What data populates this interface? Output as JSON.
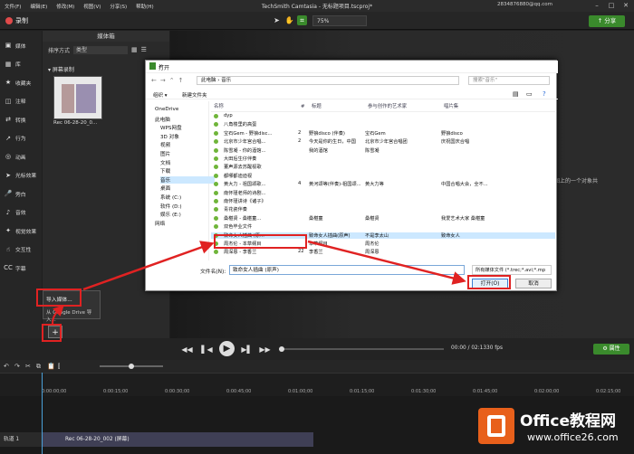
{
  "menubar": {
    "items": [
      "文件(F)",
      "编辑(E)",
      "修改(M)",
      "视图(V)",
      "分享(S)",
      "帮助(H)"
    ],
    "title": "TechSmith Camtasia - 无标题项目.tscproj*",
    "email": "2834876880@qq.com"
  },
  "toolbar": {
    "record": "录制",
    "zoom": "75%",
    "share": "分享"
  },
  "sidebar": {
    "items": [
      {
        "icon": "media-icon",
        "label": "媒体"
      },
      {
        "icon": "library-icon",
        "label": "库"
      },
      {
        "icon": "favorites-icon",
        "label": "收藏夹"
      },
      {
        "icon": "annotations-icon",
        "label": "注释"
      },
      {
        "icon": "transitions-icon",
        "label": "转换"
      },
      {
        "icon": "behaviors-icon",
        "label": "行为"
      },
      {
        "icon": "animations-icon",
        "label": "动画"
      },
      {
        "icon": "cursor-effects-icon",
        "label": "光标效果"
      },
      {
        "icon": "narration-icon",
        "label": "旁白"
      },
      {
        "icon": "audio-effects-icon",
        "label": "音效"
      },
      {
        "icon": "visual-effects-icon",
        "label": "视觉效果"
      },
      {
        "icon": "interactivity-icon",
        "label": "交互性"
      },
      {
        "icon": "captions-icon",
        "label": "字幕"
      }
    ]
  },
  "media": {
    "title": "媒体箱",
    "sort_label": "排序方式",
    "sort_value": "类型",
    "section": "屏幕录制",
    "thumb_caption": "Rec 06-28-20_0...",
    "import_menu": "导入媒体...",
    "google_menu": "从 Google Drive 导入...",
    "add_symbol": "+"
  },
  "canvas": {
    "side_text": "拖放图上的一个对象共属性。"
  },
  "playback": {
    "timecode": "00:00 / 02:13",
    "fps": "30 fps",
    "properties": "属性"
  },
  "timeline": {
    "ticks": [
      "0:00:00;00",
      "0:00:15;00",
      "0:00:30;00",
      "0:00:45;00",
      "0:01:00;00",
      "0:01:15;00",
      "0:01:30;00",
      "0:01:45;00",
      "0:02:00;00",
      "0:02:15;00"
    ],
    "track_label": "轨道 1",
    "clip_label": "Rec 06-28-20_002 (屏幕)"
  },
  "dialog": {
    "title": "打开",
    "path": "此电脑 › 音乐",
    "search": "搜索\"音乐\"",
    "organize": "组织 ▾",
    "new_folder": "新建文件夹",
    "nav": [
      "OneDrive",
      "此电脑",
      "WPS网盘",
      "3D 对象",
      "视频",
      "图片",
      "文档",
      "下载",
      "音乐",
      "桌面",
      "系统 (C:)",
      "软件 (D:)",
      "娱乐 (E:)",
      "网络"
    ],
    "columns": [
      "名称",
      "#",
      "标题",
      "参与创作的艺术家",
      "唱片集"
    ],
    "files": [
      [
        "dyp",
        "",
        "",
        "",
        ""
      ],
      [
        "八角楼里的高蛋",
        "",
        "",
        "",
        ""
      ],
      [
        "宝石Gem - 野狼disc...",
        "2",
        "野狼disco (伴奏)",
        "宝石Gem",
        "野狼disco"
      ],
      [
        "北京市少年宫合唱...",
        "2",
        "今天是你的生日，中国",
        "北京市少年宫合唱团",
        "庆祝国庆合唱"
      ],
      [
        "陈雪凝 - 你的酒馆...",
        "",
        "我的酒馆",
        "陈雪凝",
        ""
      ],
      [
        "大田后生仔伴奏",
        "",
        "",
        "",
        ""
      ],
      [
        "董声源去苏醒视歌",
        "",
        "",
        "",
        ""
      ],
      [
        "都哪都迪迪视",
        "",
        "",
        "",
        ""
      ],
      [
        "黄大力 - 祖国颂歌...",
        "4",
        "黄河颂等(伴奏)-祖国颂...",
        "黄大力等",
        "中国合唱大会，全不..."
      ],
      [
        "南怀瑾老师的诗剧...",
        "",
        "",
        "",
        ""
      ],
      [
        "南怀瑾讲诗《诸子》",
        "",
        "",
        "",
        ""
      ],
      [
        "青花瓷伴奏",
        "",
        "",
        "",
        ""
      ],
      [
        "桑椹贤 - 桑椹童...",
        "",
        "桑椹童",
        "桑椹贤",
        "我爱艺术大家 桑椹童"
      ],
      [
        "双色毕业文件",
        "",
        "",
        "",
        ""
      ],
      [
        "致命女人插曲 (原...",
        "",
        "致命女人插曲(原声)",
        "不是李太山",
        "致命女人"
      ],
      [
        "周杰伦 - 本草纲目",
        "",
        "本草纲目",
        "周杰伦",
        ""
      ],
      [
        "周深恩 - 李香兰",
        "22",
        "李香兰",
        "周深恩",
        ""
      ]
    ],
    "filename_label": "文件名(N):",
    "filename": "致命女人插曲 (原声)",
    "filetype": "所有媒体文件 (*.trec;*.avi;*.mp",
    "open": "打开(O)",
    "cancel": "取消"
  },
  "watermark": {
    "title": "Office教程网",
    "url": "www.office26.com"
  }
}
